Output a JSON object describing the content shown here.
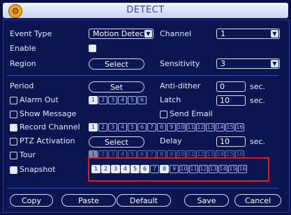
{
  "window": {
    "title": "DETECT"
  },
  "event_type": {
    "label": "Event Type",
    "value": "Motion Detect"
  },
  "channel": {
    "label": "Channel",
    "value": "1"
  },
  "enable": {
    "label": "Enable",
    "checked": true
  },
  "region": {
    "label": "Region",
    "button": "Select"
  },
  "sensitivity": {
    "label": "Sensitivity",
    "value": "3"
  },
  "period": {
    "label": "Period",
    "button": "Set"
  },
  "anti_dither": {
    "label": "Anti-dither",
    "value": "0",
    "unit": "sec."
  },
  "alarm_out": {
    "label": "Alarm Out",
    "checked": false,
    "outputs": [
      "1",
      "2",
      "3",
      "4",
      "5",
      "6"
    ],
    "on": [
      true,
      false,
      false,
      false,
      false,
      false
    ]
  },
  "latch": {
    "label": "Latch",
    "value": "10",
    "unit": "sec."
  },
  "show_message": {
    "label": "Show Message",
    "checked": false
  },
  "send_email": {
    "label": "Send Email",
    "checked": false
  },
  "record_channel": {
    "label": "Record Channel",
    "checked": true,
    "channels": [
      "1",
      "2",
      "3",
      "4",
      "5",
      "6",
      "7",
      "8",
      "9",
      "10",
      "11",
      "12",
      "13",
      "14",
      "15",
      "16"
    ],
    "on": [
      true,
      false,
      false,
      false,
      false,
      false,
      false,
      false,
      false,
      false,
      false,
      false,
      false,
      false,
      false,
      false
    ]
  },
  "ptz_activation": {
    "label": "PTZ Activation",
    "checked": false,
    "button": "Select"
  },
  "delay": {
    "label": "Delay",
    "value": "10",
    "unit": "sec."
  },
  "tour": {
    "label": "Tour",
    "checked": false,
    "channels": [
      "1",
      "2",
      "3",
      "4",
      "5",
      "6",
      "7",
      "8",
      "9",
      "10",
      "11",
      "12",
      "13",
      "14",
      "15",
      "16"
    ],
    "on": [
      true,
      false,
      false,
      false,
      false,
      false,
      false,
      false,
      false,
      false,
      false,
      false,
      false,
      false,
      false,
      false
    ]
  },
  "snapshot": {
    "label": "Snapshot",
    "checked": true,
    "channels": [
      "1",
      "2",
      "3",
      "4",
      "5",
      "6",
      "7",
      "8",
      "9",
      "10",
      "11",
      "12",
      "13",
      "14",
      "15",
      "16"
    ],
    "on": [
      true,
      true,
      true,
      true,
      true,
      true,
      false,
      true,
      false,
      false,
      false,
      false,
      false,
      false,
      false,
      false
    ]
  },
  "buttons": {
    "copy": "Copy",
    "paste": "Paste",
    "default": "Default",
    "save": "Save",
    "cancel": "Cancel"
  },
  "colors": {
    "background": "#0b1650",
    "highlight": "#e01b1b",
    "title_text": "#2a3fb2"
  }
}
